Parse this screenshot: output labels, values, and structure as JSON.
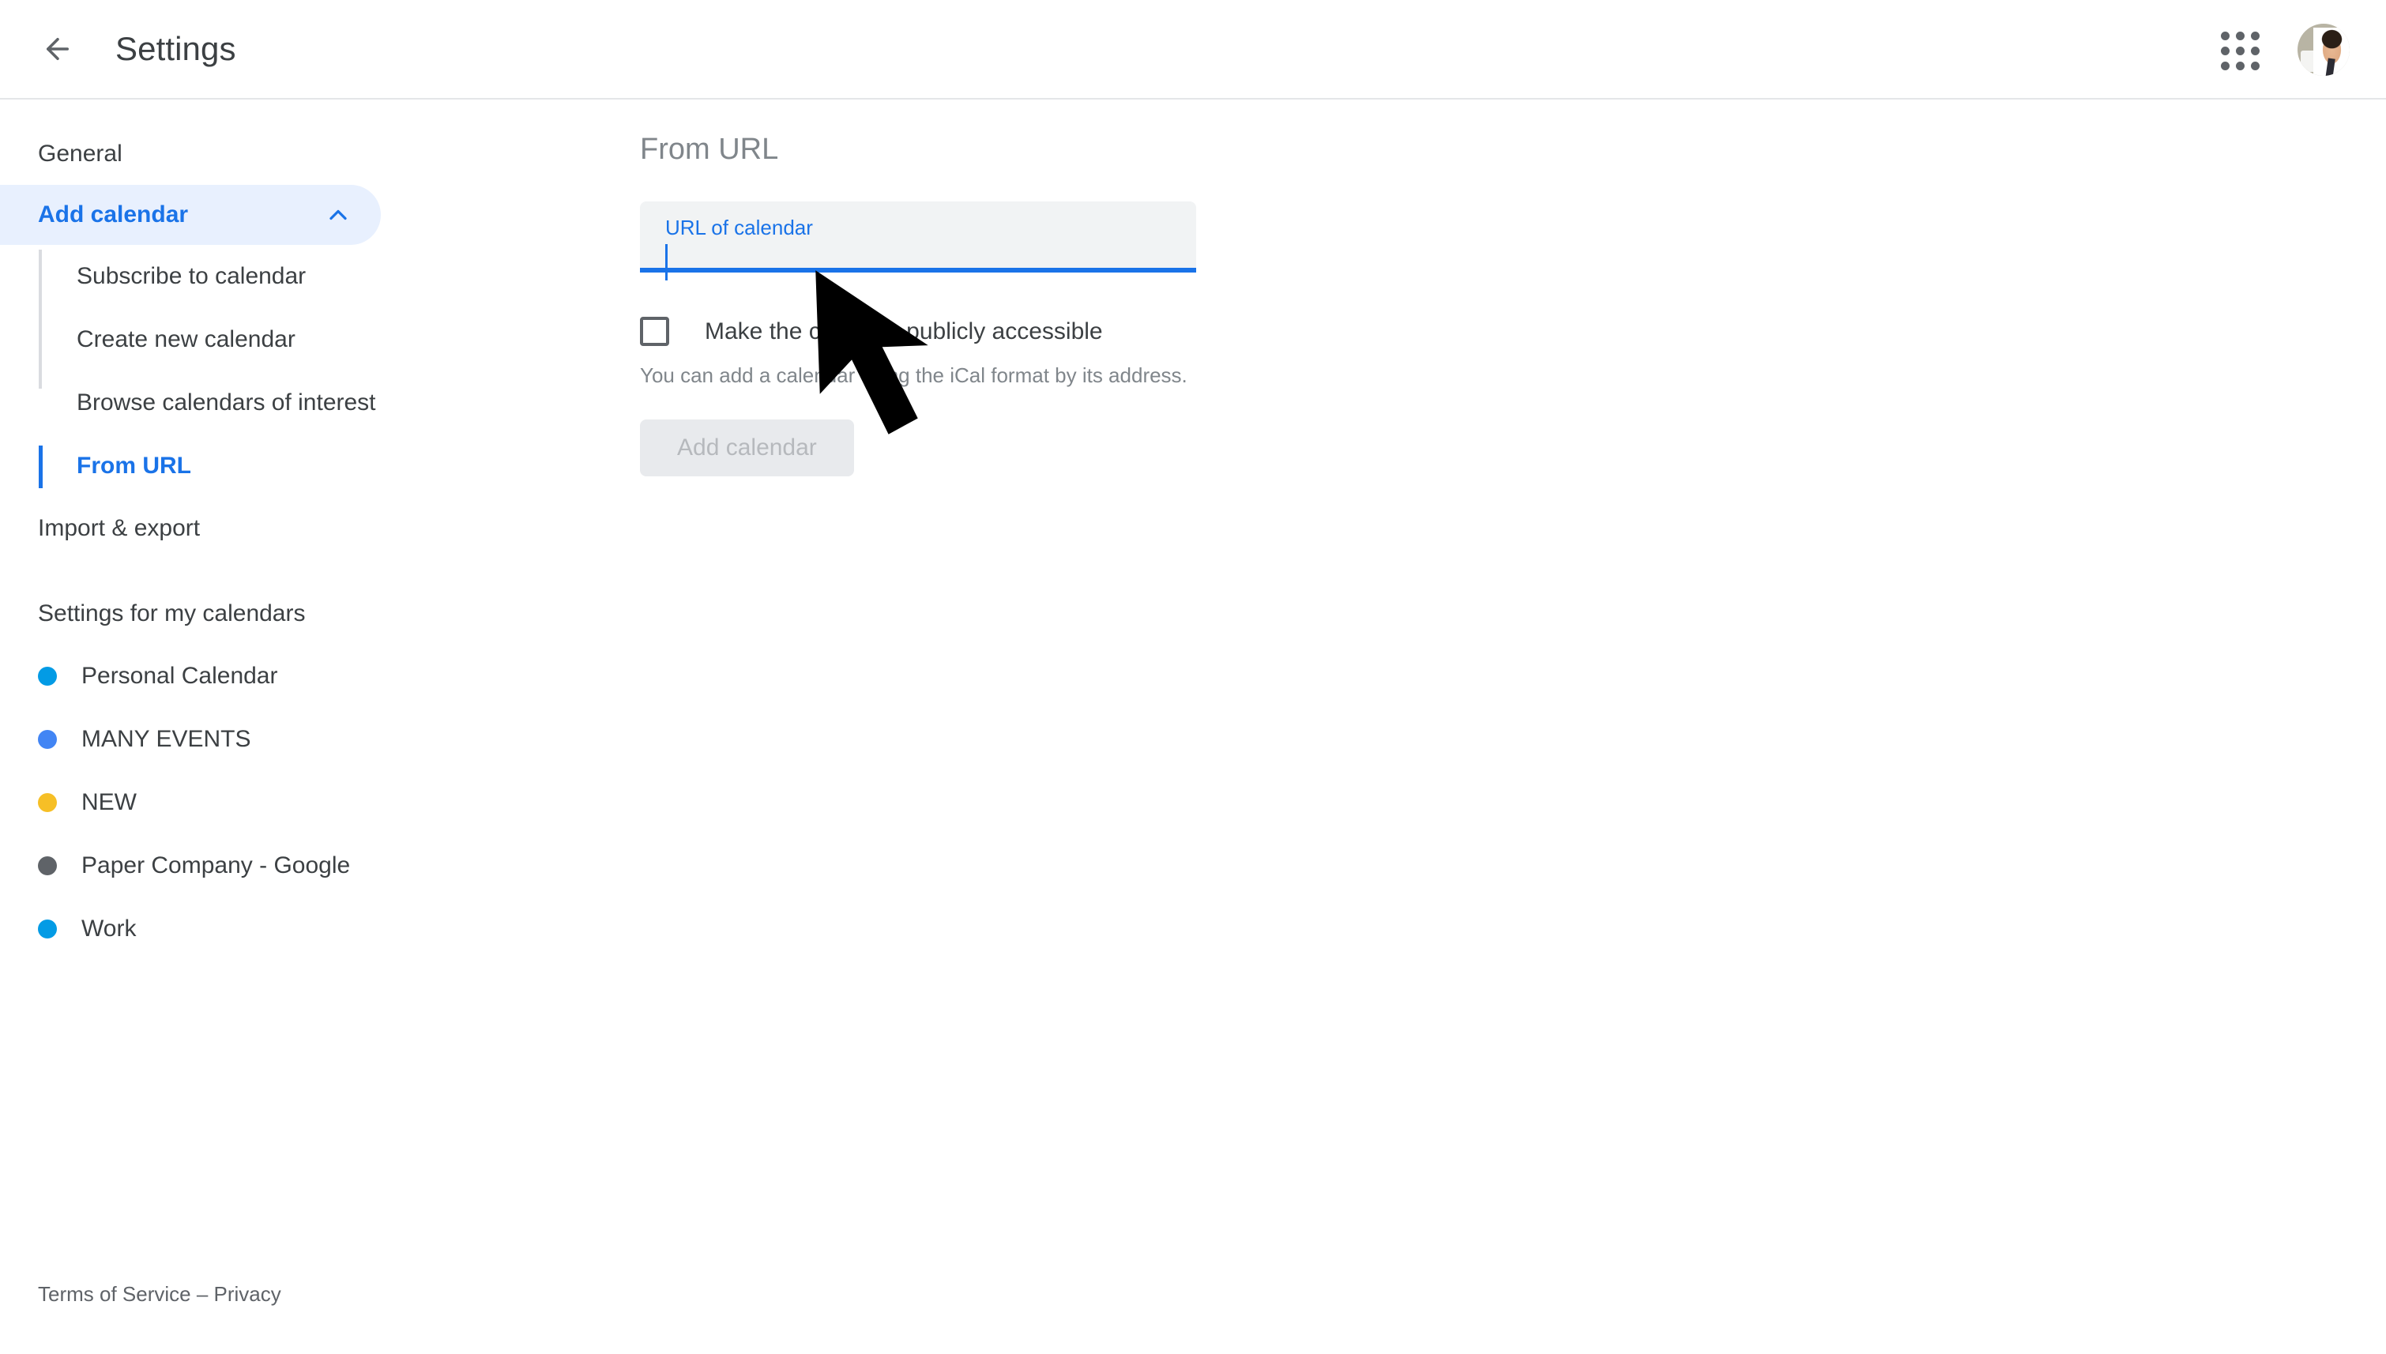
{
  "header": {
    "back_icon": "arrow-left-icon",
    "title": "Settings",
    "apps_icon": "apps-grid-icon",
    "avatar_icon": "user-avatar"
  },
  "sidebar": {
    "items": [
      {
        "label": "General"
      },
      {
        "label": "Add calendar"
      },
      {
        "label": "Import & export"
      }
    ],
    "add_calendar_expanded": true,
    "collapse_icon": "chevron-up-icon",
    "sub_items": [
      {
        "label": "Subscribe to calendar"
      },
      {
        "label": "Create new calendar"
      },
      {
        "label": "Browse calendars of interest"
      },
      {
        "label": "From URL"
      }
    ],
    "active_sub_item": "From URL",
    "calendars_section_title": "Settings for my calendars",
    "calendars": [
      {
        "name": "Personal Calendar",
        "color": "#039be5"
      },
      {
        "name": "MANY EVENTS",
        "color": "#4285f4"
      },
      {
        "name": "NEW",
        "color": "#f6bf26"
      },
      {
        "name": "Paper Company - Google",
        "color": "#5f6368"
      },
      {
        "name": "Work",
        "color": "#039be5"
      }
    ]
  },
  "main": {
    "panel_title": "From URL",
    "url_field": {
      "label": "URL of calendar",
      "value": "",
      "placeholder": "URL of calendar"
    },
    "public_checkbox": {
      "label": "Make the calendar publicly accessible",
      "checked": false
    },
    "help_text": "You can add a calendar using the iCal format by its address.",
    "add_button": {
      "label": "Add calendar",
      "disabled": true
    }
  },
  "footer": {
    "terms": "Terms of Service",
    "separator": " – ",
    "privacy": "Privacy"
  },
  "colors": {
    "accent": "#1a73e8",
    "pill_background": "#e8f0fe",
    "field_background": "#f1f3f4",
    "text_primary": "#3c4043",
    "text_secondary": "#80868b"
  },
  "cursor": {
    "icon": "mouse-arrow-cursor"
  }
}
